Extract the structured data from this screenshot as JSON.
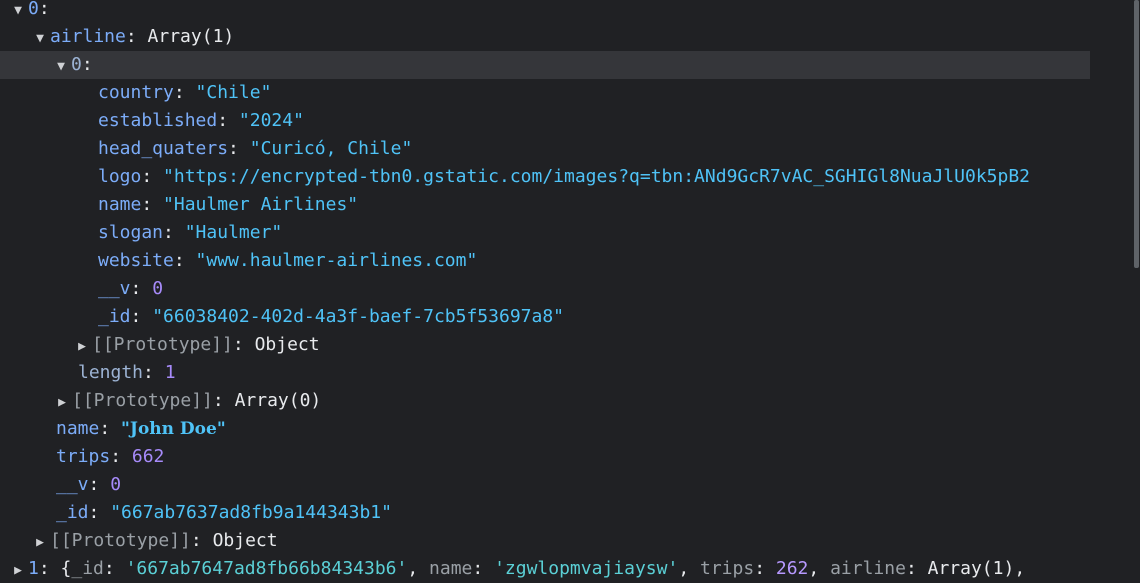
{
  "tree": {
    "item0": {
      "index": "0",
      "colon": ":"
    },
    "airline": {
      "key": "airline",
      "summary": "Array(1)"
    },
    "airline_item0": {
      "index": "0",
      "colon": ":"
    },
    "fields": [
      {
        "key": "country",
        "value": "\"Chile\""
      },
      {
        "key": "established",
        "value": "\"2024\""
      },
      {
        "key": "head_quaters",
        "value": "\"Curicó, Chile\""
      },
      {
        "key": "logo",
        "value": "\"https://encrypted-tbn0.gstatic.com/images?q=tbn:ANd9GcR7vAC_SGHIGl8NuaJlU0k5pB2"
      },
      {
        "key": "name",
        "value": "\"Haulmer Airlines\""
      },
      {
        "key": "slogan",
        "value": "\"Haulmer\""
      },
      {
        "key": "website",
        "value": "\"www.haulmer-airlines.com\""
      },
      {
        "key": "__v",
        "value": "0"
      },
      {
        "key": "_id",
        "value": "\"66038402-402d-4a3f-baef-7cb5f53697a8\""
      }
    ],
    "airline_item_proto": {
      "key": "[[Prototype]]",
      "value": "Object"
    },
    "length": {
      "key": "length",
      "value": "1"
    },
    "airline_proto": {
      "key": "[[Prototype]]",
      "value": "Array(0)"
    },
    "name": {
      "key": "name",
      "value": "\"John Doe\""
    },
    "trips": {
      "key": "trips",
      "value": "662"
    },
    "v": {
      "key": "__v",
      "value": "0"
    },
    "id": {
      "key": "_id",
      "value": "\"667ab7637ad8fb9a144343b1\""
    },
    "proto": {
      "key": "[[Prototype]]",
      "value": "Object"
    },
    "item1": {
      "index": "1",
      "open": "{",
      "id_key": "_id",
      "id_val": "'667ab7647ad8fb66b84343b6'",
      "name_key": "name",
      "name_val": "'zgwlopmvajiaysw'",
      "trips_key": "trips",
      "trips_val": "262",
      "airline_key": "airline",
      "airline_val": "Array(1),"
    }
  },
  "icons": {
    "expanded": "triangle-down",
    "collapsed": "triangle-right"
  }
}
